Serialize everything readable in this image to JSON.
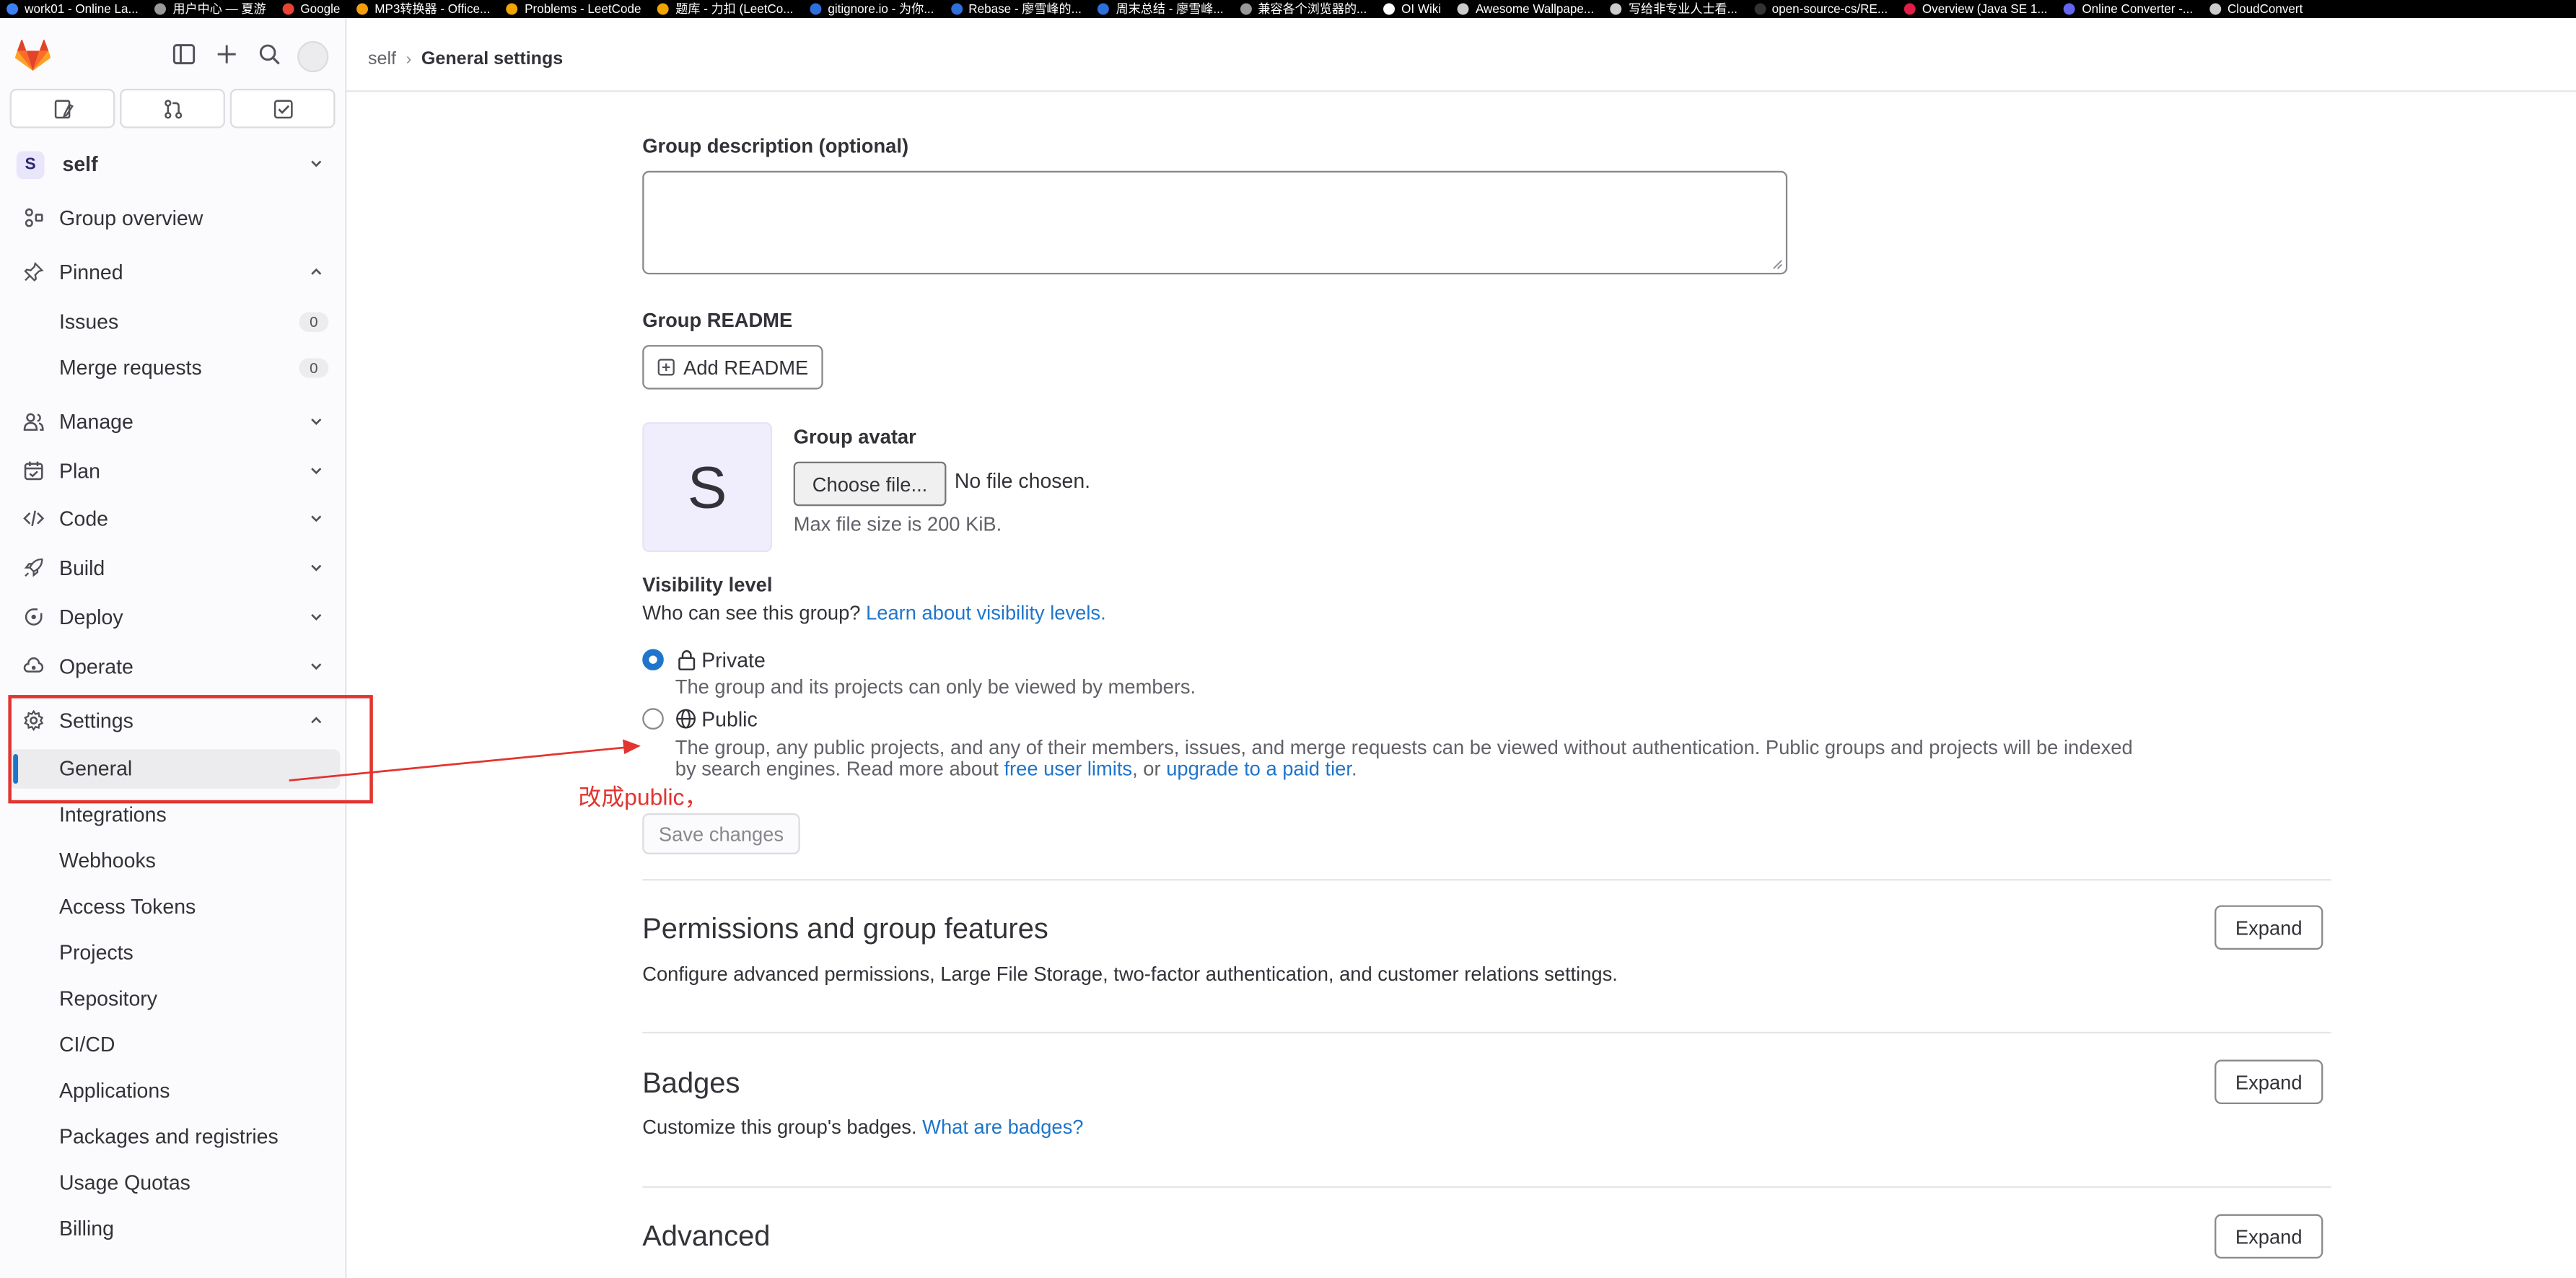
{
  "bookmarks": [
    {
      "label": "work01 - Online La...",
      "color": "#3b82f6"
    },
    {
      "label": "用户中心 — 夏游",
      "color": "#999999"
    },
    {
      "label": "Google",
      "color": "#ea4335"
    },
    {
      "label": "MP3转换器 - Office...",
      "color": "#f59e0b"
    },
    {
      "label": "Problems - LeetCode",
      "color": "#f0a500"
    },
    {
      "label": "题库 - 力扣 (LeetCo...",
      "color": "#f0a500"
    },
    {
      "label": "gitignore.io - 为你...",
      "color": "#2d6fdb"
    },
    {
      "label": "Rebase - 廖雪峰的...",
      "color": "#2d6fdb"
    },
    {
      "label": "周末总结 - 廖雪峰...",
      "color": "#2d6fdb"
    },
    {
      "label": "兼容各个浏览器的...",
      "color": "#999999"
    },
    {
      "label": "OI Wiki",
      "color": "#ffffff"
    },
    {
      "label": "Awesome Wallpape...",
      "color": "#cccccc"
    },
    {
      "label": "写给非专业人士看...",
      "color": "#cccccc"
    },
    {
      "label": "open-source-cs/RE...",
      "color": "#333333"
    },
    {
      "label": "Overview (Java SE 1...",
      "color": "#e11d48"
    },
    {
      "label": "Online Converter -...",
      "color": "#6366f1"
    },
    {
      "label": "CloudConvert",
      "color": "#cccccc"
    }
  ],
  "sidebar": {
    "context_initial": "S",
    "context_name": "self",
    "group_overview": "Group overview",
    "pinned": "Pinned",
    "pinned_items": [
      {
        "label": "Issues",
        "count": "0"
      },
      {
        "label": "Merge requests",
        "count": "0"
      }
    ],
    "sections": [
      "Manage",
      "Plan",
      "Code",
      "Build",
      "Deploy",
      "Operate"
    ],
    "settings": "Settings",
    "settings_items": [
      "General",
      "Integrations",
      "Webhooks",
      "Access Tokens",
      "Projects",
      "Repository",
      "CI/CD",
      "Applications",
      "Packages and registries",
      "Usage Quotas",
      "Billing"
    ]
  },
  "breadcrumb": {
    "parent": "self",
    "current": "General settings"
  },
  "form": {
    "description_label": "Group description (optional)",
    "readme_label": "Group README",
    "add_readme": "Add README",
    "avatar_initial": "S",
    "avatar_label": "Group avatar",
    "choose_file": "Choose file...",
    "no_file": "No file chosen.",
    "max_size": "Max file size is 200 KiB.",
    "visibility_label": "Visibility level",
    "visibility_question": "Who can see this group?",
    "visibility_link": "Learn about visibility levels.",
    "private_label": "Private",
    "private_help": "The group and its projects can only be viewed by members.",
    "public_label": "Public",
    "public_help_1": "The group, any public projects, and any of their members, issues, and merge requests can be viewed without authentication. Public groups and projects will be indexed",
    "public_help_2": "by search engines. Read more about",
    "free_user_limits": "free user limits",
    "or_text": ", or",
    "upgrade": "upgrade to a paid tier",
    "period": ".",
    "save": "Save changes",
    "selected_visibility": "private"
  },
  "sections": [
    {
      "title": "Permissions and group features",
      "desc": "Configure advanced permissions, Large File Storage, two-factor authentication, and customer relations settings.",
      "link": "",
      "expand": "Expand"
    },
    {
      "title": "Badges",
      "desc": "Customize this group's badges.",
      "link": "What are badges?",
      "expand": "Expand"
    },
    {
      "title": "Advanced",
      "desc": "",
      "link": "",
      "expand": "Expand"
    }
  ],
  "annotation": "改成public，",
  "colors": {
    "annotation": "#e3342f",
    "link": "#1f75cb",
    "radio_selected": "#1f75cb"
  }
}
